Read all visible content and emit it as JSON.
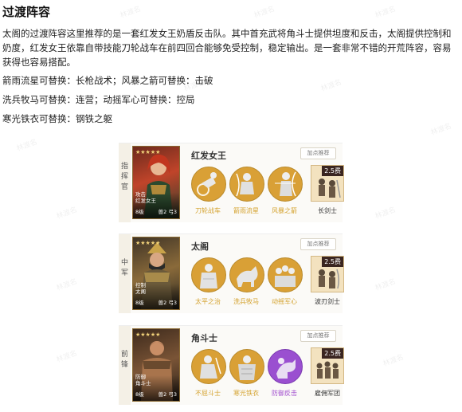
{
  "watermark": "林渡名",
  "article": {
    "title": "过渡阵容",
    "description": "太阁的过渡阵容这里推荐的是一套红发女王奶盾反击队。其中首充武将角斗士提供坦度和反击，太阁提供控制和奶度，红发女王依靠自带技能刀轮战车在前四回合能够免受控制，稳定输出。是一套非常不错的开荒阵容，容易获得也容易搭配。",
    "lines": [
      "箭雨流星可替换：长枪战术；风暴之箭可替换：击破",
      "洗兵牧马可替换：连营；动摇军心可替换：控局",
      "寒光铁衣可替换：钢铁之躯"
    ]
  },
  "lineup": {
    "add_points_label": "加点推荐",
    "cards": [
      {
        "position": "指挥官",
        "hero_name": "红发女王",
        "portrait_name": "红发女王",
        "portrait_tag": "攻击",
        "level": "8级",
        "stats": "兽2 弓3",
        "stars": "★★★★★",
        "skills": [
          {
            "name": "刀轮战车",
            "color": "gold",
            "icon": "chariot-icon"
          },
          {
            "name": "箭雨流星",
            "color": "gold",
            "icon": "archer-icon"
          },
          {
            "name": "风暴之箭",
            "color": "gold",
            "icon": "bow-icon"
          }
        ],
        "unit": {
          "cost": "2.5费",
          "name": "长剑士",
          "icon": "swordsman-icon"
        }
      },
      {
        "position": "中军",
        "hero_name": "太阁",
        "portrait_name": "太阁",
        "portrait_tag": "控制",
        "level": "8级",
        "stats": "兽2 弓3",
        "stars": "★★★★★",
        "skills": [
          {
            "name": "太平之治",
            "color": "gold",
            "icon": "monk-icon"
          },
          {
            "name": "洗兵牧马",
            "color": "gold",
            "icon": "horse-icon"
          },
          {
            "name": "动摇军心",
            "color": "gold",
            "icon": "crowd-icon"
          }
        ],
        "unit": {
          "cost": "2.5费",
          "name": "波刃剑士",
          "icon": "swordsman-icon"
        }
      },
      {
        "position": "前锋",
        "hero_name": "角斗士",
        "portrait_name": "角斗士",
        "portrait_tag": "防御",
        "level": "8级",
        "stats": "兽2 弓3",
        "stars": "★★★★★",
        "skills": [
          {
            "name": "不屈斗士",
            "color": "gold",
            "icon": "fighter-icon"
          },
          {
            "name": "寒光铁衣",
            "color": "gold",
            "icon": "armor-icon"
          },
          {
            "name": "防御反击",
            "color": "purple",
            "icon": "counter-icon"
          }
        ],
        "unit": {
          "cost": "2.5费",
          "name": "雇佣军团",
          "icon": "mercenary-icon"
        }
      }
    ]
  }
}
